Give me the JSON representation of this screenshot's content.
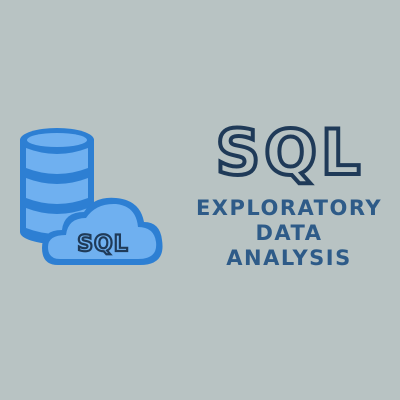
{
  "illustration": {
    "icons": [
      "database-icon",
      "cloud-icon"
    ],
    "cloud_label": "SQL"
  },
  "headline": {
    "text": "SQL"
  },
  "subtitle": {
    "lines": [
      "EXPLORATORY",
      "DATA",
      "ANALYSIS"
    ]
  },
  "colors": {
    "background": "#b8c3c3",
    "accent_blue": "#2d7fd3",
    "light_blue": "#6fb0f0",
    "outline_navy": "#1f3a58",
    "subtitle_blue": "#2e5b88"
  }
}
